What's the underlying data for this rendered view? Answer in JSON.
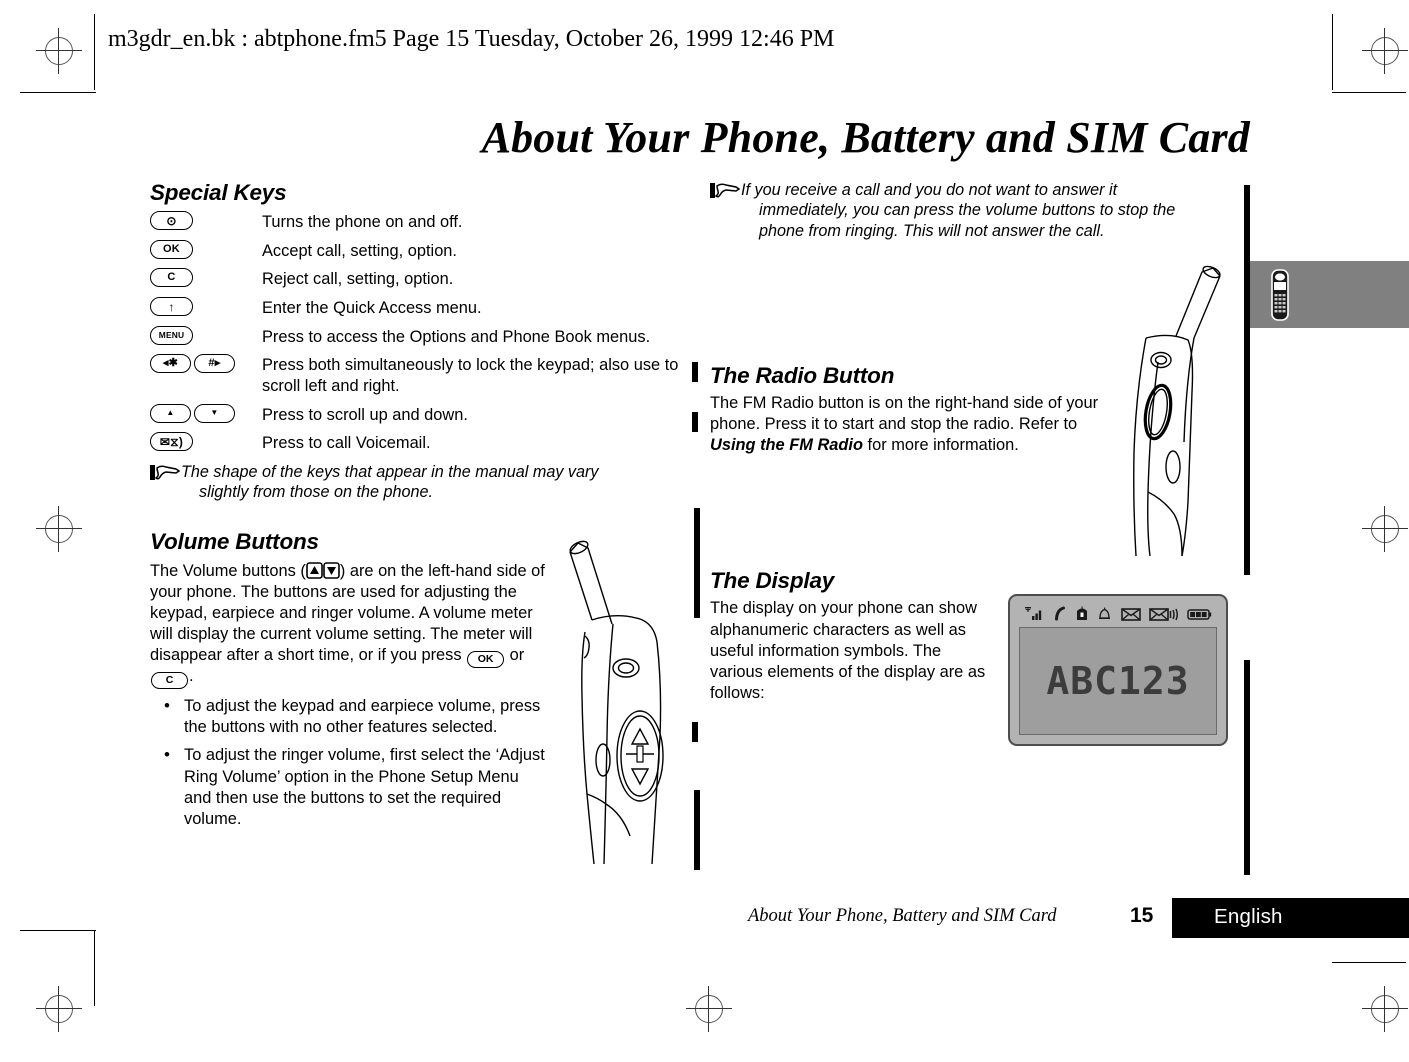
{
  "document": {
    "header_line": "m3gdr_en.bk : abtphone.fm5  Page 15  Tuesday, October 26, 1999  12:46 PM",
    "page_title": "About Your Phone, Battery and SIM Card",
    "footer_title": "About Your Phone, Battery and SIM Card",
    "footer_page_number": "15",
    "footer_language": "English",
    "edge_tab_icon": "mobile-phone-icon"
  },
  "left_column": {
    "special_keys": {
      "heading": "Special Keys",
      "rows": [
        {
          "keys": [
            {
              "label": "⊙",
              "style": "glyph"
            }
          ],
          "description": "Turns the phone on and off."
        },
        {
          "keys": [
            {
              "label": "OK",
              "style": "text"
            }
          ],
          "description": "Accept call, setting, option."
        },
        {
          "keys": [
            {
              "label": "C",
              "style": "text"
            }
          ],
          "description": "Reject call, setting, option."
        },
        {
          "keys": [
            {
              "label": "↑",
              "style": "glyph"
            }
          ],
          "description": "Enter the Quick Access menu."
        },
        {
          "keys": [
            {
              "label": "MENU",
              "style": "menu"
            }
          ],
          "description": "Press to access the Options and Phone Book menus."
        },
        {
          "keys": [
            {
              "label": "◂✱",
              "style": "glyph"
            },
            {
              "label": "#▸",
              "style": "glyph"
            }
          ],
          "description": "Press both simultaneously to lock the keypad; also use to scroll left and right."
        },
        {
          "keys": [
            {
              "label": "▲",
              "style": "tiny"
            },
            {
              "label": "▼",
              "style": "tiny"
            }
          ],
          "description": "Press to scroll up and down."
        },
        {
          "keys": [
            {
              "label": "✉⧖)",
              "style": "glyph"
            }
          ],
          "description": "Press to call Voicemail."
        }
      ],
      "note": {
        "icon": "pointing-hand-icon",
        "line1": "The shape of the keys that appear in the manual may vary",
        "line2": "slightly from those on the phone."
      }
    },
    "volume_buttons": {
      "heading": "Volume Buttons",
      "paragraph_part1": "The Volume buttons (",
      "paragraph_part2": ") are on the left-hand side of your phone. The buttons are used for adjusting the keypad, earpiece and ringer volume. A volume meter will display the current volume setting. The meter will disappear after a short time, or if you press ",
      "inline_key_ok": "OK",
      "paragraph_part3": " or ",
      "inline_key_c": "C",
      "paragraph_part4": ".",
      "bullets": [
        "To adjust the keypad and earpiece volume, press the buttons with no other features selected.",
        "To adjust the ringer volume, first select the ‘Adjust Ring Volume’ option in the Phone Setup Menu and then use the buttons to set the required volume."
      ],
      "illustration": "phone-side-view-volume-buttons"
    }
  },
  "right_column": {
    "top_note": {
      "icon": "pointing-hand-icon",
      "line1": "If you receive a call and you do not want to answer it",
      "line2": "immediately, you can press the volume buttons to stop the",
      "line3": "phone from ringing. This will not answer the call."
    },
    "radio_button": {
      "heading": "The Radio Button",
      "text_part1": "The FM Radio button is on the right-hand side of your phone. Press it to start and stop the radio. Refer to ",
      "text_bold": "Using the FM Radio",
      "text_part2": " for more information.",
      "illustration": "phone-side-view-radio-button"
    },
    "display": {
      "heading": "The Display",
      "text": "The display on your phone can show alphanumeric characters as well as useful information symbols. The various elements of the display are as follows:",
      "lcd_text": "ABC123",
      "status_icons": [
        "signal-strength-icon",
        "call-in-progress-icon",
        "mailbox-icon",
        "alarm-bell-icon",
        "message-envelope-icon",
        "voicemail-envelope-icon",
        "battery-icon"
      ]
    }
  },
  "colors": {
    "page_background": "#ffffff",
    "text": "#000000",
    "tab_gray": "#808080",
    "display_bezel": "#b3b3b3",
    "display_screen": "#9e9e9e",
    "lcd_ink": "#3c3c3c"
  }
}
